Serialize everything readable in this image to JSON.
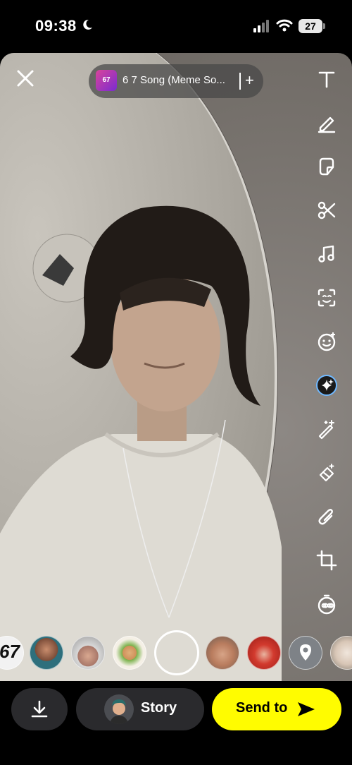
{
  "status_bar": {
    "time": "09:38",
    "battery": "27"
  },
  "music": {
    "art_text": "67",
    "title": "6 7 Song (Meme So...",
    "add_label": "+"
  },
  "toolbar": {
    "tools": [
      "text-icon",
      "pencil-icon",
      "sticker-icon",
      "scissors-icon",
      "music-note-icon",
      "scan-icon",
      "emoji-icon",
      "ai-sparkle-icon",
      "magic-wand-icon",
      "eraser-icon",
      "paperclip-icon",
      "crop-icon",
      "timer-icon"
    ]
  },
  "lenses": {
    "first_badge": "67"
  },
  "actions": {
    "story_label": "Story",
    "send_label": "Send to"
  },
  "colors": {
    "send_button": "#fffc00",
    "dark_pill": "#2a2a2d"
  }
}
